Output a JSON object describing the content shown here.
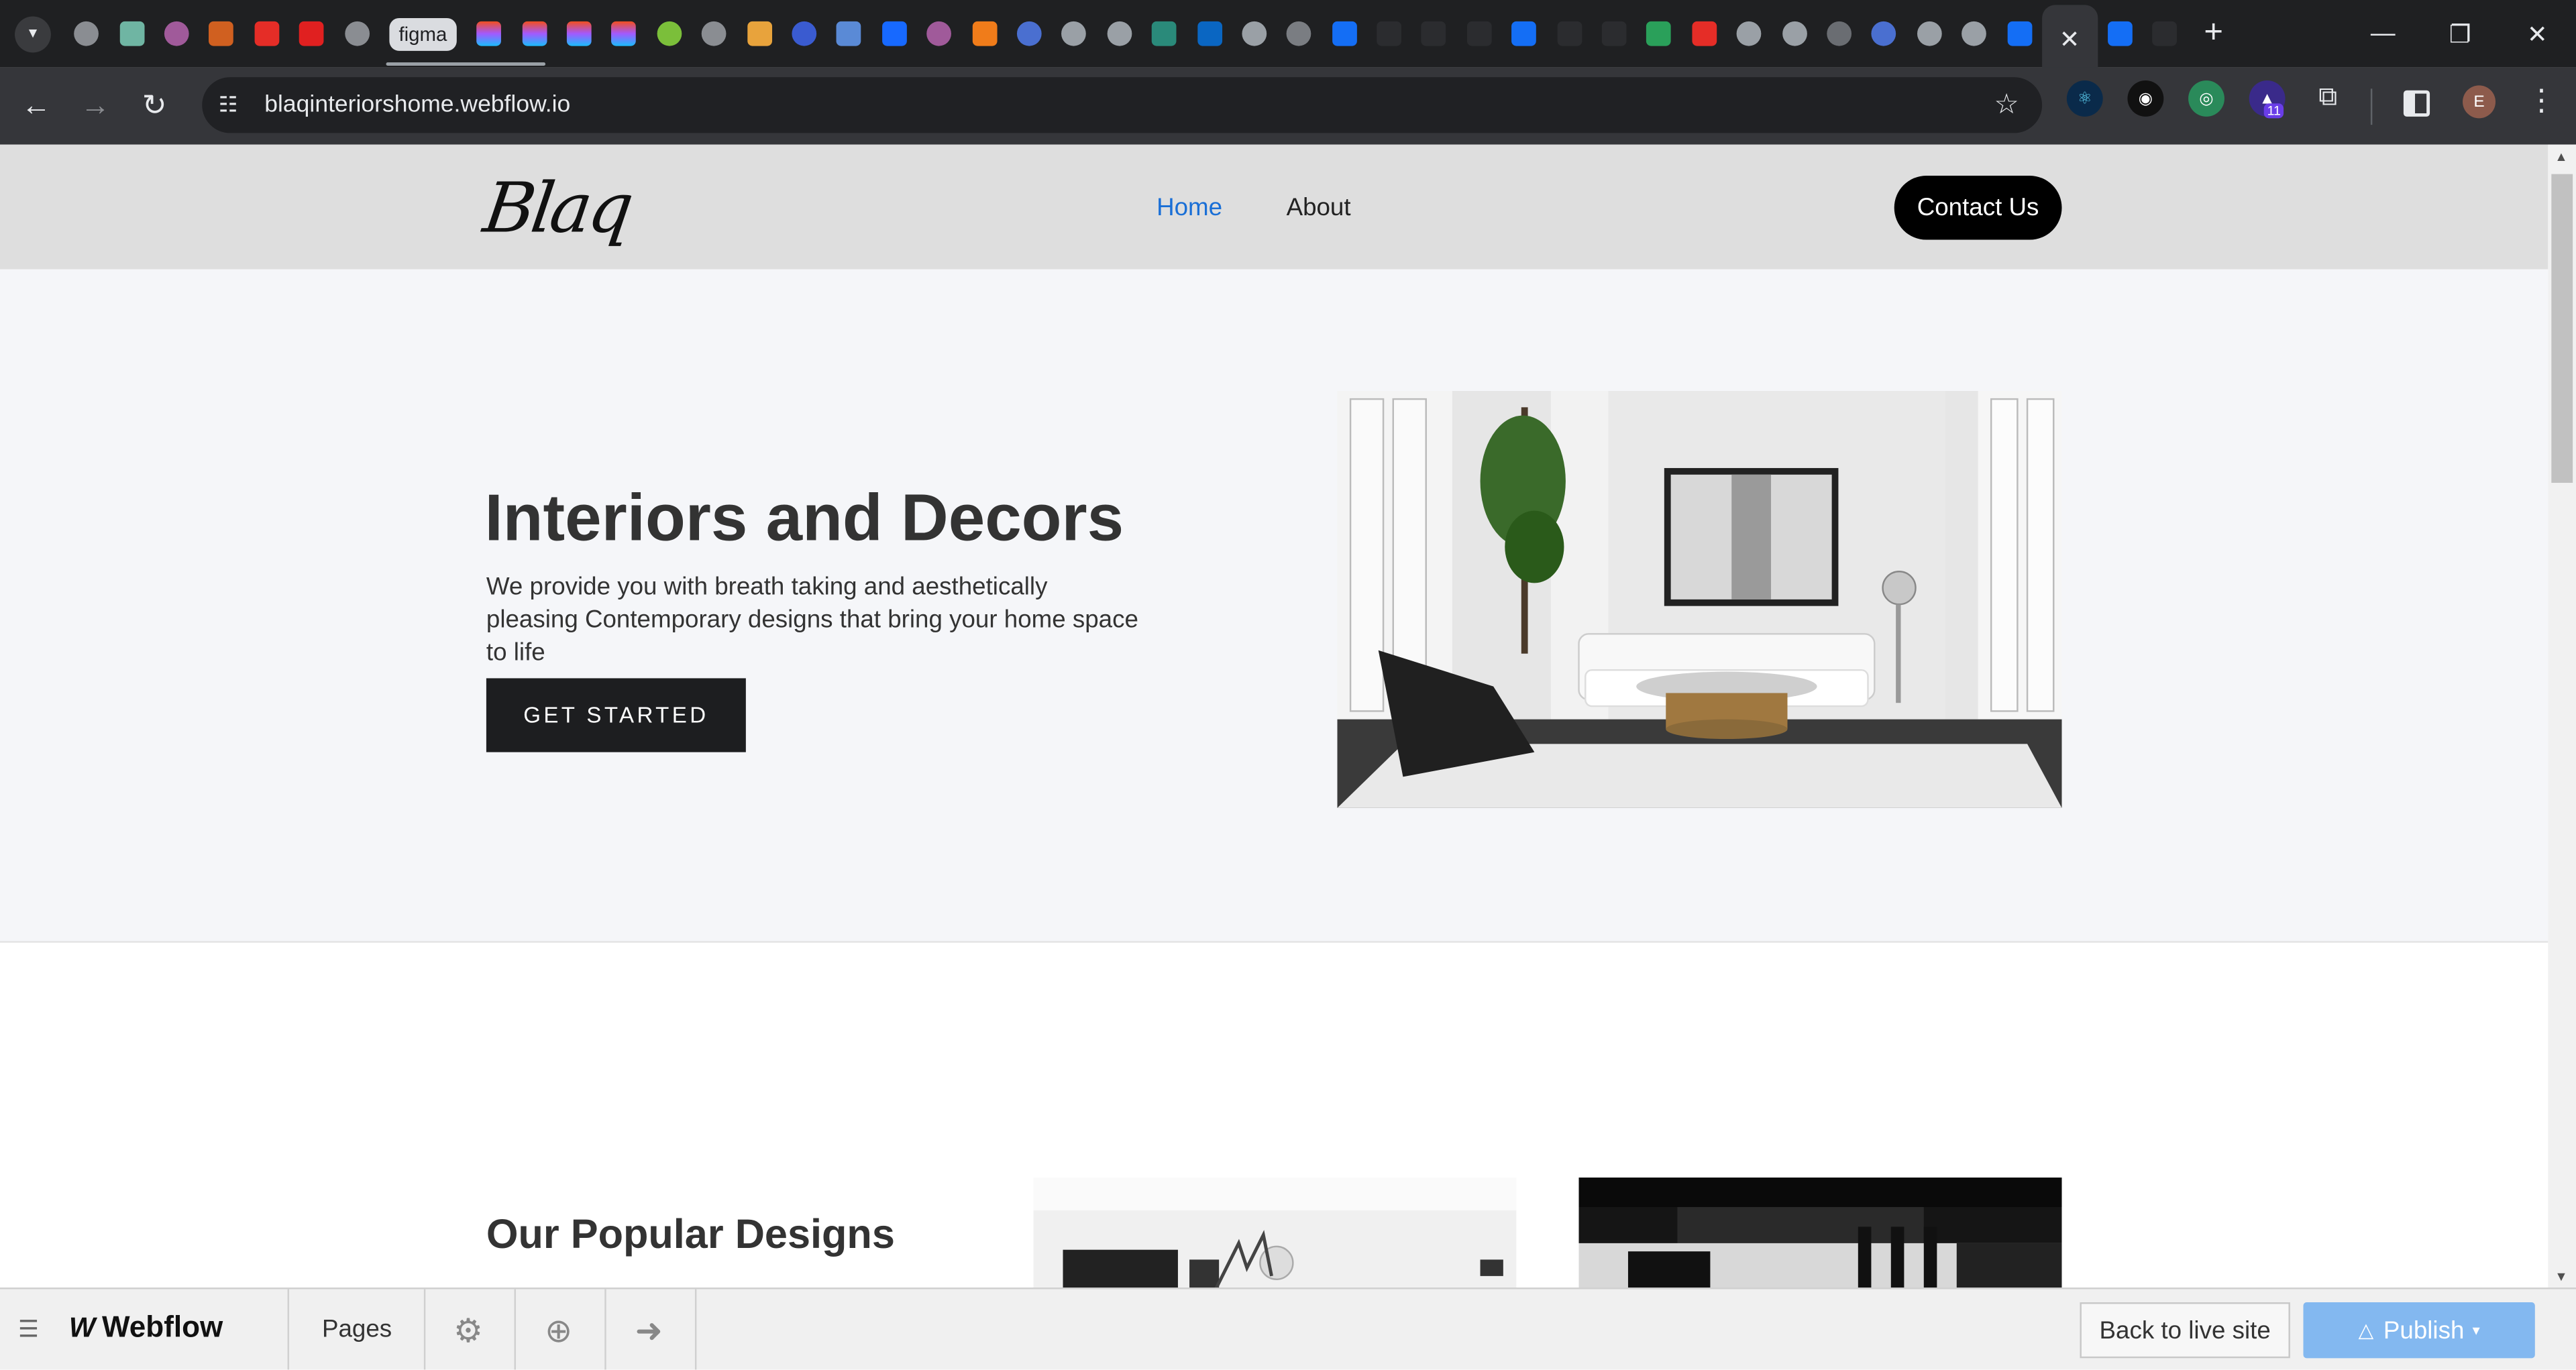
{
  "browser": {
    "figma_tab_label": "figma",
    "close_tab_glyph": "✕",
    "new_tab_glyph": "+",
    "window_controls": {
      "minimize": "—",
      "restore": "❐",
      "close": "✕"
    },
    "url": "blaqinteriorshome.webflow.io",
    "extension_badge": "11",
    "profile_initial": "E"
  },
  "site": {
    "logo": "Blaq",
    "nav": {
      "home": "Home",
      "about": "About",
      "contact": "Contact Us"
    },
    "nav_active_color": "#1a6fd6",
    "hero": {
      "title": "Interiors and Decors",
      "description": "We provide you with breath taking and aesthetically pleasing Contemporary designs that bring your home space to life",
      "cta": "GET STARTED"
    },
    "popular": {
      "title": "Our Popular Designs"
    }
  },
  "webflow": {
    "brand": "Webflow",
    "pages": "Pages",
    "back_to_live": "Back to live site",
    "publish": "Publish"
  }
}
